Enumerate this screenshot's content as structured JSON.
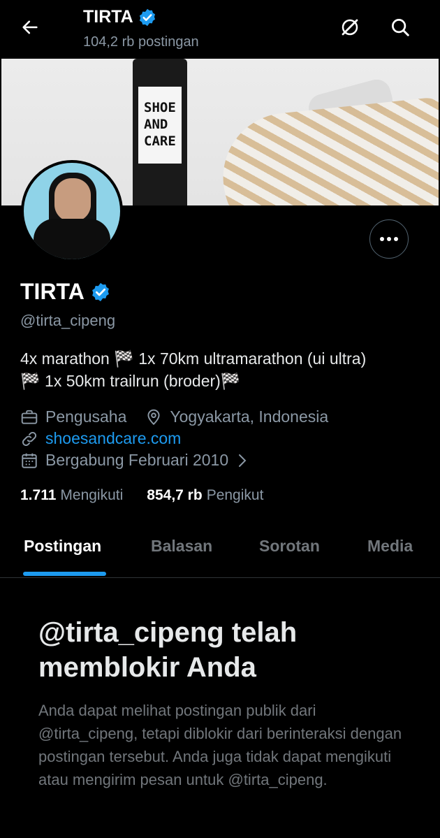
{
  "header": {
    "title": "TIRTA",
    "post_count": "104,2 rb postingan"
  },
  "banner": {
    "bottle_text": "SHOE AND CARE"
  },
  "profile": {
    "name": "TIRTA",
    "handle": "@tirta_cipeng",
    "bio_line1": "4x marathon 🏁 1x 70km ultramarathon (ui ultra)",
    "bio_line2": "🏁 1x 50km trailrun (broder)🏁",
    "occupation": "Pengusaha",
    "location": "Yogyakarta, Indonesia",
    "website": "shoesandcare.com",
    "joined": "Bergabung Februari 2010",
    "following_count": "1.711",
    "following_label": "Mengikuti",
    "followers_count": "854,7 rb",
    "followers_label": "Pengikut"
  },
  "tabs": [
    {
      "label": "Postingan",
      "active": true
    },
    {
      "label": "Balasan",
      "active": false
    },
    {
      "label": "Sorotan",
      "active": false
    },
    {
      "label": "Media",
      "active": false
    }
  ],
  "blocked": {
    "title": "@tirta_cipeng telah memblokir Anda",
    "message": "Anda dapat melihat postingan publik dari @tirta_cipeng, tetapi diblokir dari berinteraksi dengan postingan tersebut. Anda juga tidak dapat mengikuti atau mengirim pesan untuk @tirta_cipeng."
  },
  "colors": {
    "accent": "#1d9bf0",
    "verified": "#1d9bf0",
    "background": "#000000",
    "secondary_text": "#8b98a5"
  },
  "icons": [
    "back-arrow-icon",
    "verified-badge-icon",
    "grok-icon",
    "search-icon",
    "more-icon",
    "briefcase-icon",
    "location-pin-icon",
    "link-icon",
    "calendar-icon",
    "chevron-right-icon"
  ]
}
